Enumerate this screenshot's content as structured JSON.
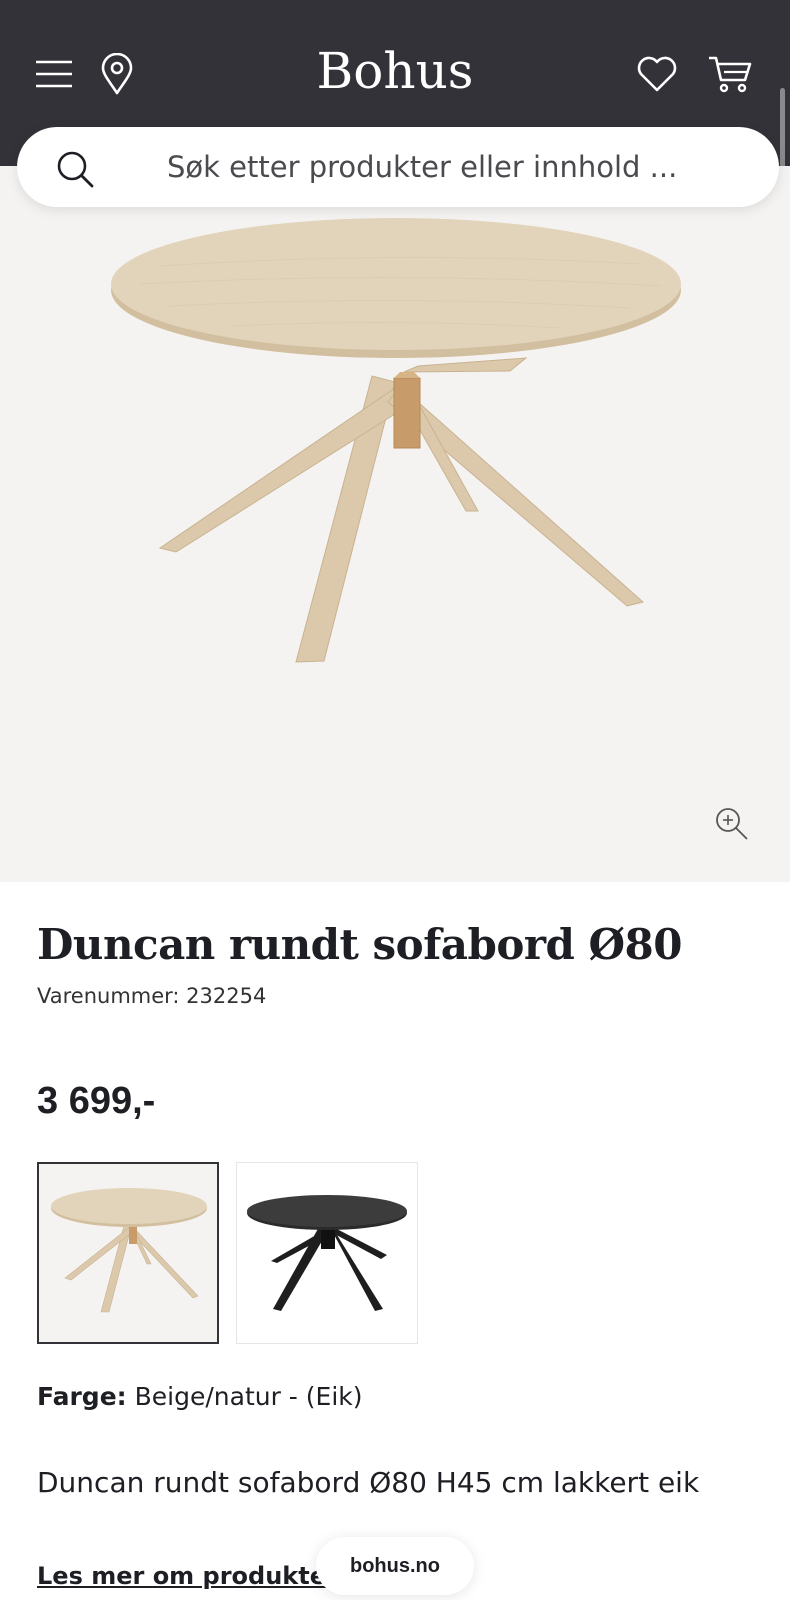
{
  "header": {
    "logo": "Bohus",
    "icons": {
      "menu": "hamburger-menu-icon",
      "location": "location-pin-icon",
      "wishlist": "heart-icon",
      "cart": "shopping-cart-icon"
    }
  },
  "search": {
    "placeholder": "Søk etter produkter eller innhold ..."
  },
  "product": {
    "title": "Duncan rundt sofabord Ø80",
    "sku": "Varenummer: 232254",
    "price": "3 699,-",
    "color_label": "Farge:",
    "color_value": "Beige/natur - (Eik)",
    "description": "Duncan rundt sofabord Ø80 H45 cm lakkert eik",
    "read_more": "Les mer om produktet",
    "variants": [
      {
        "name": "Beige/natur - (Eik)",
        "selected": true
      },
      {
        "name": "Svart",
        "selected": false
      }
    ]
  },
  "browser": {
    "domain": "bohus.no"
  },
  "colors": {
    "header_bg": "#333238",
    "hero_bg": "#f5f3f2",
    "text": "#1e1f24",
    "wood": "#dccbb0"
  }
}
